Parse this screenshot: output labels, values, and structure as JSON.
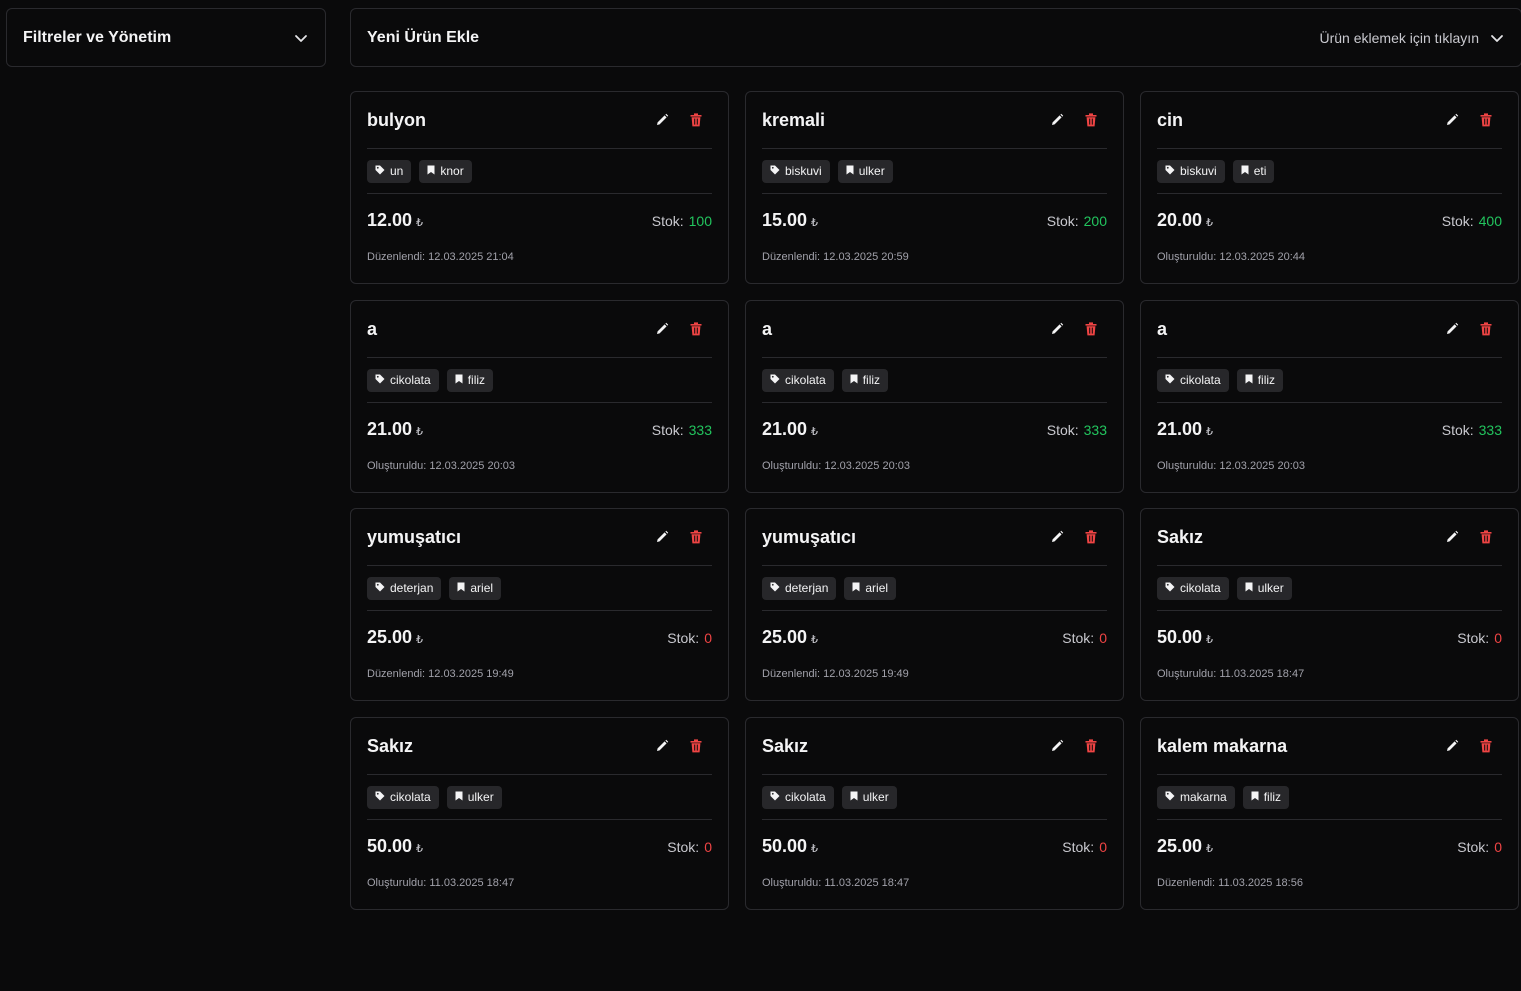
{
  "filters": {
    "title": "Filtreler ve Yönetim",
    "icon": "chevron-down-icon"
  },
  "add_product": {
    "title": "Yeni Ürün Ekle",
    "hint": "Ürün eklemek için tıklayın",
    "icon": "chevron-down-icon"
  },
  "labels": {
    "stock": "Stok:",
    "currency": "₺"
  },
  "colors": {
    "in_stock": "#22c55e",
    "out_of_stock": "#ef4444",
    "delete": "#ef4444"
  },
  "products": [
    {
      "name": "bulyon",
      "category": "un",
      "brand": "knor",
      "price": "12.00",
      "stock": "100",
      "meta": "Düzenlendi: 12.03.2025 21:04"
    },
    {
      "name": "kremali",
      "category": "biskuvi",
      "brand": "ulker",
      "price": "15.00",
      "stock": "200",
      "meta": "Düzenlendi: 12.03.2025 20:59"
    },
    {
      "name": "cin",
      "category": "biskuvi",
      "brand": "eti",
      "price": "20.00",
      "stock": "400",
      "meta": "Oluşturuldu: 12.03.2025 20:44"
    },
    {
      "name": "a",
      "category": "cikolata",
      "brand": "filiz",
      "price": "21.00",
      "stock": "333",
      "meta": "Oluşturuldu: 12.03.2025 20:03"
    },
    {
      "name": "a",
      "category": "cikolata",
      "brand": "filiz",
      "price": "21.00",
      "stock": "333",
      "meta": "Oluşturuldu: 12.03.2025 20:03"
    },
    {
      "name": "a",
      "category": "cikolata",
      "brand": "filiz",
      "price": "21.00",
      "stock": "333",
      "meta": "Oluşturuldu: 12.03.2025 20:03"
    },
    {
      "name": "yumuşatıcı",
      "category": "deterjan",
      "brand": "ariel",
      "price": "25.00",
      "stock": "0",
      "meta": "Düzenlendi: 12.03.2025 19:49"
    },
    {
      "name": "yumuşatıcı",
      "category": "deterjan",
      "brand": "ariel",
      "price": "25.00",
      "stock": "0",
      "meta": "Düzenlendi: 12.03.2025 19:49"
    },
    {
      "name": "Sakız",
      "category": "cikolata",
      "brand": "ulker",
      "price": "50.00",
      "stock": "0",
      "meta": "Oluşturuldu: 11.03.2025 18:47"
    },
    {
      "name": "Sakız",
      "category": "cikolata",
      "brand": "ulker",
      "price": "50.00",
      "stock": "0",
      "meta": "Oluşturuldu: 11.03.2025 18:47"
    },
    {
      "name": "Sakız",
      "category": "cikolata",
      "brand": "ulker",
      "price": "50.00",
      "stock": "0",
      "meta": "Oluşturuldu: 11.03.2025 18:47"
    },
    {
      "name": "kalem makarna",
      "category": "makarna",
      "brand": "filiz",
      "price": "25.00",
      "stock": "0",
      "meta": "Düzenlendi: 11.03.2025 18:56"
    }
  ]
}
